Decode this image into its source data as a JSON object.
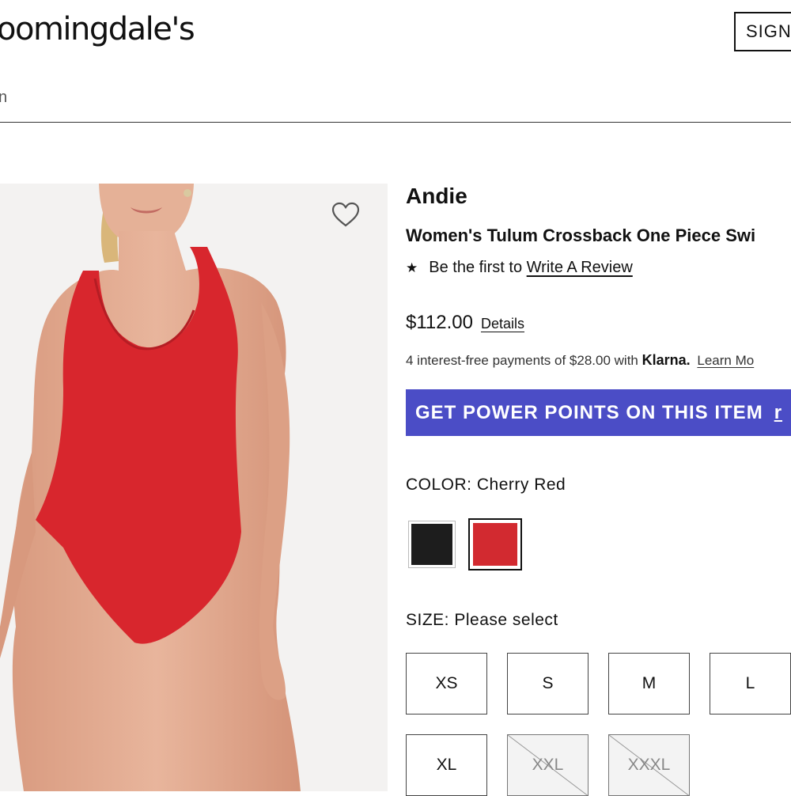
{
  "header": {
    "logo_text": "oomingdale's",
    "sign_in_label": "SIGN",
    "search_fragment": "n"
  },
  "product": {
    "brand": "Andie",
    "name": "Women's Tulum Crossback One Piece Swi",
    "review_prefix": "Be the first to",
    "review_link": "Write A Review",
    "price": "$112.00",
    "price_details": "Details",
    "klarna": {
      "text": "4 interest-free payments of $28.00 with",
      "brand": "Klarna.",
      "learn_more": "Learn Mo"
    },
    "power_points": {
      "label": "GET POWER POINTS ON THIS ITEM",
      "extra": "r",
      "color": "#4b4dc6"
    },
    "color": {
      "label": "COLOR:",
      "value": "Cherry Red",
      "swatches": [
        {
          "name": "black",
          "hex": "#1d1d1d",
          "selected": false
        },
        {
          "name": "cherry-red",
          "hex": "#d22a30",
          "selected": true
        }
      ]
    },
    "size": {
      "label": "SIZE:",
      "value": "Please select",
      "options": [
        {
          "label": "XS",
          "available": true
        },
        {
          "label": "S",
          "available": true
        },
        {
          "label": "M",
          "available": true
        },
        {
          "label": "L",
          "available": true
        },
        {
          "label": "XL",
          "available": true
        },
        {
          "label": "XXL",
          "available": false
        },
        {
          "label": "XXXL",
          "available": false
        }
      ]
    }
  },
  "icons": {
    "wishlist": "heart-outline-icon",
    "review_star": "star-icon"
  }
}
